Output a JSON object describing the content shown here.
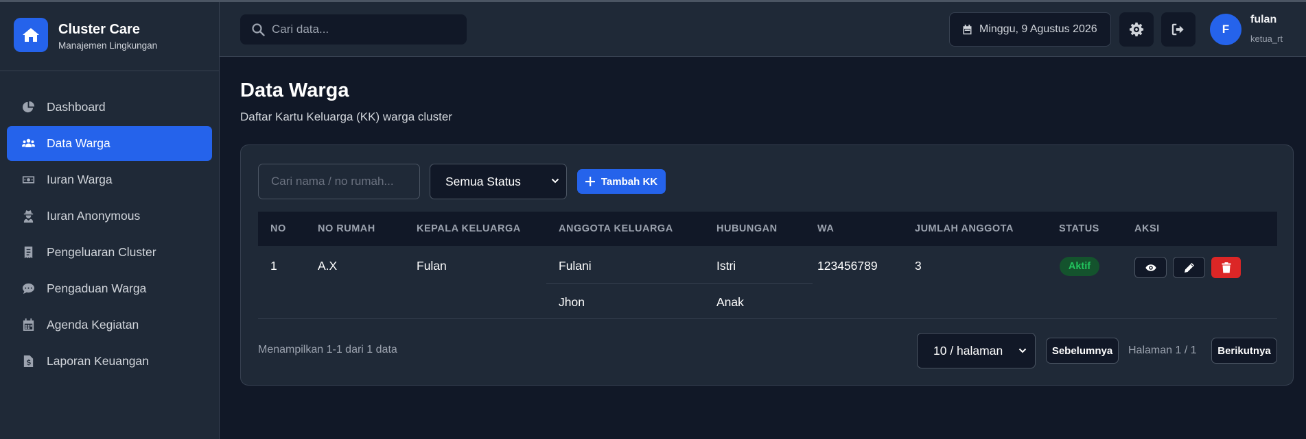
{
  "brand": {
    "title": "Cluster Care",
    "subtitle": "Manajemen Lingkungan",
    "logo_icon": "home-icon"
  },
  "sidebar": {
    "items": [
      {
        "label": "Dashboard",
        "icon": "pie-chart-icon",
        "active": false
      },
      {
        "label": "Data Warga",
        "icon": "users-icon",
        "active": true
      },
      {
        "label": "Iuran Warga",
        "icon": "money-icon",
        "active": false
      },
      {
        "label": "Iuran Anonymous",
        "icon": "user-secret-icon",
        "active": false
      },
      {
        "label": "Pengeluaran Cluster",
        "icon": "receipt-icon",
        "active": false
      },
      {
        "label": "Pengaduan Warga",
        "icon": "comment-icon",
        "active": false
      },
      {
        "label": "Agenda Kegiatan",
        "icon": "calendar-icon",
        "active": false
      },
      {
        "label": "Laporan Keuangan",
        "icon": "file-invoice-icon",
        "active": false
      }
    ]
  },
  "topbar": {
    "search_placeholder": "Cari data...",
    "date": "Minggu, 9 Agustus 2026",
    "user": {
      "initial": "F",
      "name": "fulan",
      "role": "ketua_rt"
    }
  },
  "page": {
    "title": "Data Warga",
    "subtitle": "Daftar Kartu Keluarga (KK) warga cluster"
  },
  "filters": {
    "search_placeholder": "Cari nama / no rumah...",
    "status_selected": "Semua Status",
    "add_button": "Tambah KK"
  },
  "table": {
    "columns": [
      "NO",
      "NO RUMAH",
      "KEPALA KELUARGA",
      "ANGGOTA KELUARGA",
      "HUBUNGAN",
      "WA",
      "JUMLAH ANGGOTA",
      "STATUS",
      "AKSI"
    ],
    "rows": [
      {
        "no": "1",
        "no_rumah": "A.X",
        "kepala": "Fulan",
        "members": [
          {
            "name": "Fulani",
            "relation": "Istri"
          },
          {
            "name": "Jhon",
            "relation": "Anak"
          }
        ],
        "wa": "123456789",
        "jumlah": "3",
        "status": "Aktif"
      }
    ]
  },
  "footer": {
    "info": "Menampilkan 1-1 dari 1 data",
    "per_page": "10 / halaman",
    "prev": "Sebelumnya",
    "page_info": "Halaman 1 / 1",
    "next": "Berikutnya"
  },
  "colors": {
    "accent": "#2563eb",
    "background": "#111827",
    "panel": "#1f2937",
    "danger": "#dc2626",
    "success": "#22c55e"
  }
}
